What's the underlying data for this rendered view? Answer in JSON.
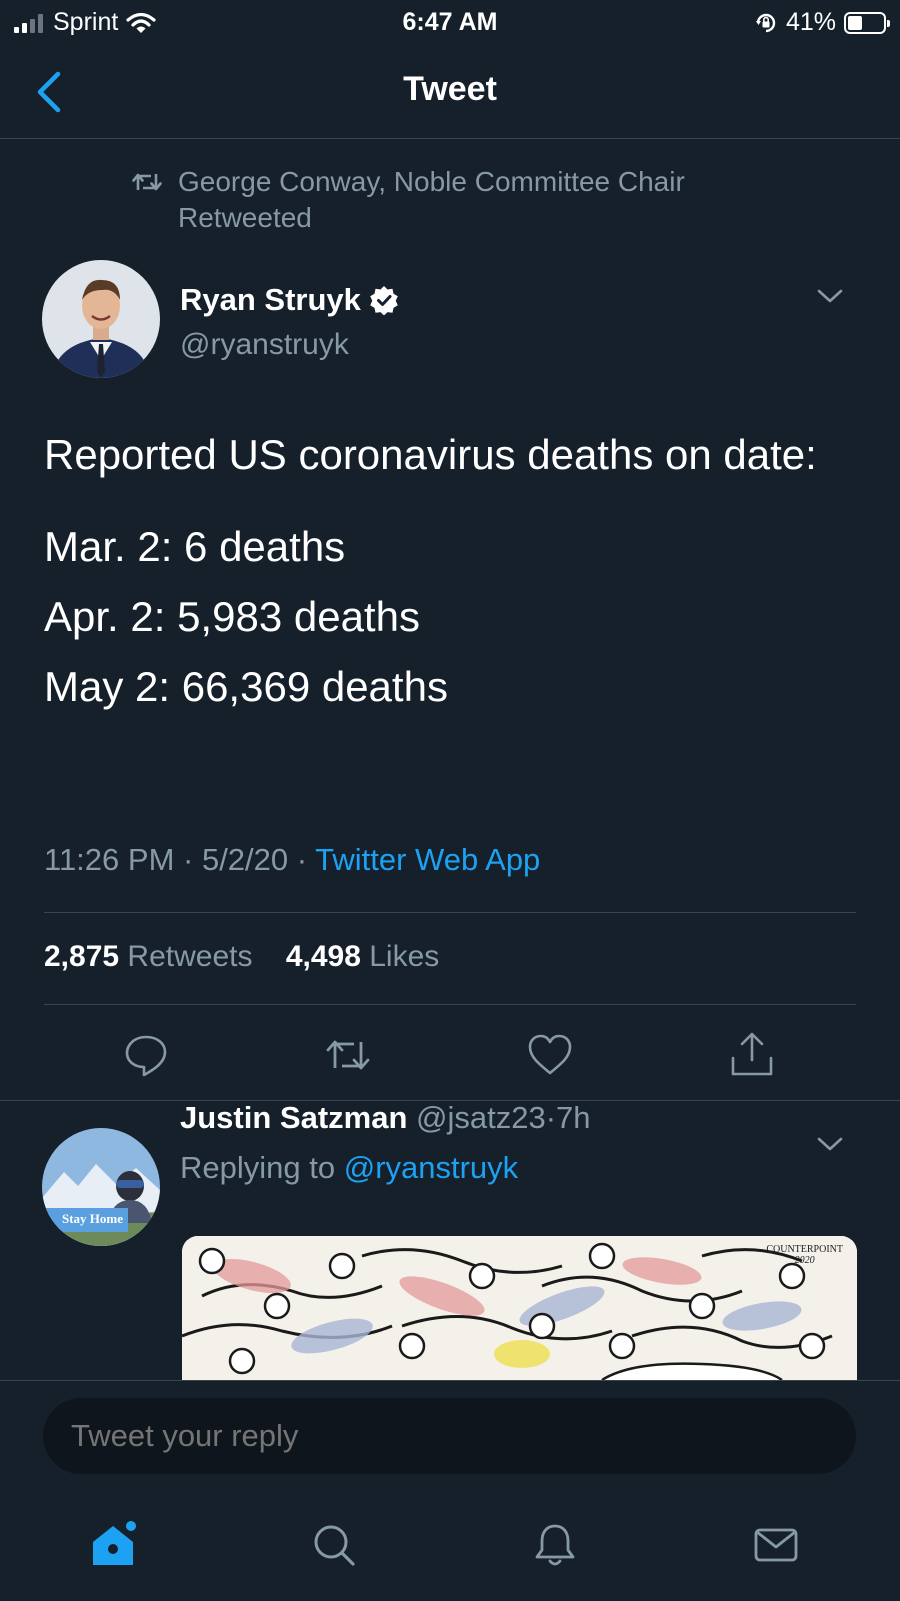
{
  "status_bar": {
    "carrier": "Sprint",
    "time": "6:47 AM",
    "battery_percent": "41%",
    "battery_level": 0.41,
    "signal_bars_filled": 2,
    "signal_bars_total": 4
  },
  "header": {
    "title": "Tweet",
    "back_icon": "chevron-left-icon"
  },
  "retweet_context": {
    "text": "George Conway, Noble Committee Chair Retweeted",
    "icon": "retweet-icon"
  },
  "tweet": {
    "author_name": "Ryan Struyk",
    "verified": true,
    "handle": "@ryanstruyk",
    "text_intro": "Reported US coronavirus deaths on date:",
    "lines": [
      "Mar. 2: 6 deaths",
      "Apr. 2: 5,983 deaths",
      "May 2: 66,369 deaths"
    ],
    "time": "11:26 PM",
    "separator": " · ",
    "date": "5/2/20",
    "source": "Twitter Web App",
    "retweets_count": "2,875",
    "retweets_label": "Retweets",
    "likes_count": "4,498",
    "likes_label": "Likes"
  },
  "reply": {
    "author_name": "Justin Satzman",
    "handle": "@jsatz23",
    "separator": "·",
    "age": "7h",
    "replying_prefix": "Replying to",
    "replying_to": "@ryanstruyk",
    "avatar_banner": "Stay Home",
    "image_credit_1": "COUNTERPOINT",
    "image_credit_2": "2020"
  },
  "compose": {
    "placeholder": "Tweet your reply"
  },
  "tabbar": {
    "items": [
      "home-icon",
      "search-icon",
      "notifications-icon",
      "messages-icon"
    ],
    "accent_color": "#1da1f2"
  },
  "colors": {
    "background": "#15202b",
    "muted": "#8899a6",
    "accent": "#1da1f2",
    "divider": "#38444d"
  }
}
